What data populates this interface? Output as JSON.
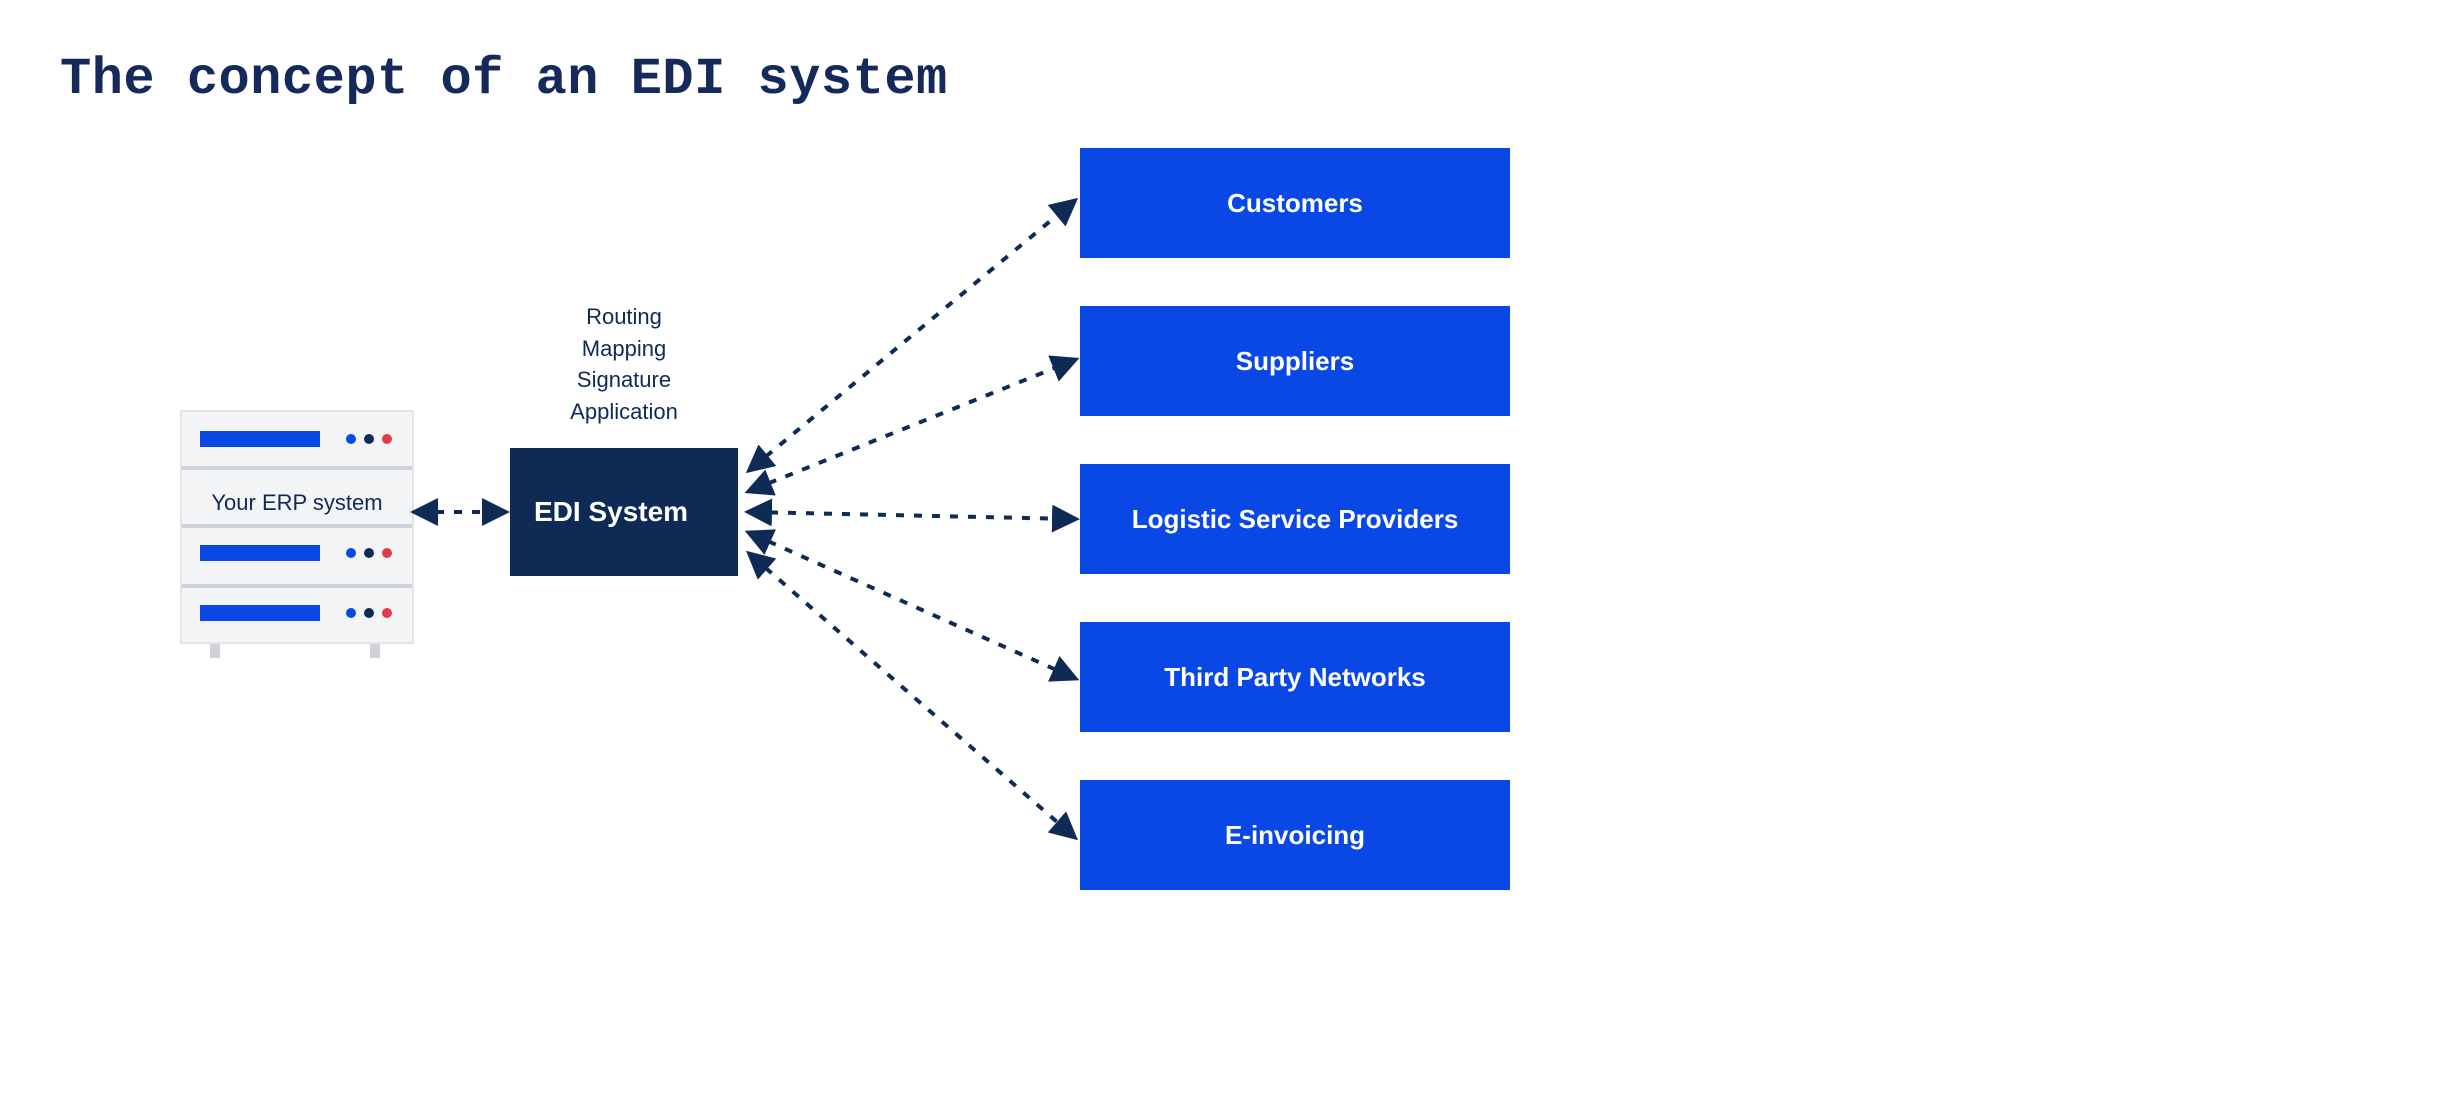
{
  "title": "The concept of an EDI system",
  "erp": {
    "label": "Your ERP system"
  },
  "edi": {
    "label": "EDI System",
    "annotations": [
      "Routing",
      "Mapping",
      "Signature",
      "Application"
    ]
  },
  "partners": [
    "Customers",
    "Suppliers",
    "Logistic Service Providers",
    "Third Party Networks",
    "E-invoicing"
  ],
  "colors": {
    "navy": "#102a56",
    "blue": "#0a48e6",
    "red": "#e23a4a"
  }
}
